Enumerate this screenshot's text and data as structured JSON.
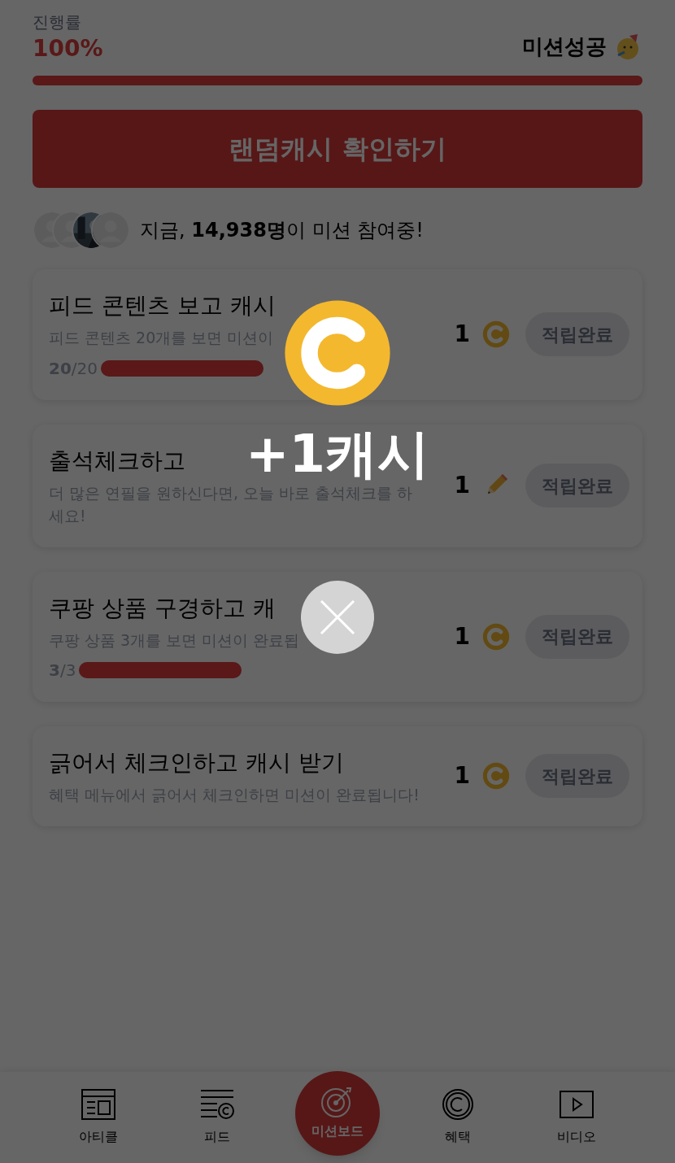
{
  "progress": {
    "label": "진행률",
    "percent": "100%",
    "status": "미션성공",
    "level": 1
  },
  "random_cash_button": "랜덤캐시 확인하기",
  "participants": {
    "avatars": [
      {
        "kind": "silhouette"
      },
      {
        "kind": "silhouette"
      },
      {
        "kind": "picture"
      },
      {
        "kind": "silhouette"
      }
    ],
    "text": "지금, **14,938명**이 미션 참여중!"
  },
  "missions": [
    {
      "kind": "coin",
      "title": "피드 콘텐츠 보고 캐시",
      "description": "피드 콘텐츠 20개를 보면 미션이",
      "counter": "**20**/20",
      "level": 1,
      "reward": "1",
      "button": "적립완료"
    },
    {
      "kind": "pencil",
      "title": "출석체크하고",
      "description": "더 많은 연필을 원하신다면, 오늘 바로 출석체크를 하세요!",
      "reward": "1",
      "button": "적립완료"
    },
    {
      "kind": "coin",
      "title": "쿠팡 상품 구경하고 캐",
      "description": "쿠팡 상품 3개를 보면 미션이 완료됩",
      "counter": "**3**/3",
      "level": 1,
      "reward": "1",
      "button": "적립완료"
    },
    {
      "kind": "coin",
      "title": "긁어서 체크인하고 캐시 받기",
      "description": "혜택 메뉴에서 긁어서 체크인하면 미션이 완료됩니다!",
      "reward": "1",
      "button": "적립완료"
    }
  ],
  "popup": {
    "amount": "+1캐시"
  },
  "nav": [
    {
      "kind": "article",
      "label": "아티클",
      "selected": false
    },
    {
      "kind": "feed",
      "label": "피드",
      "selected": false
    },
    {
      "kind": "target",
      "label": "미션보드",
      "selected": true
    },
    {
      "kind": "coin",
      "label": "혜택",
      "selected": false
    },
    {
      "kind": "video",
      "label": "비디오",
      "selected": false
    }
  ]
}
